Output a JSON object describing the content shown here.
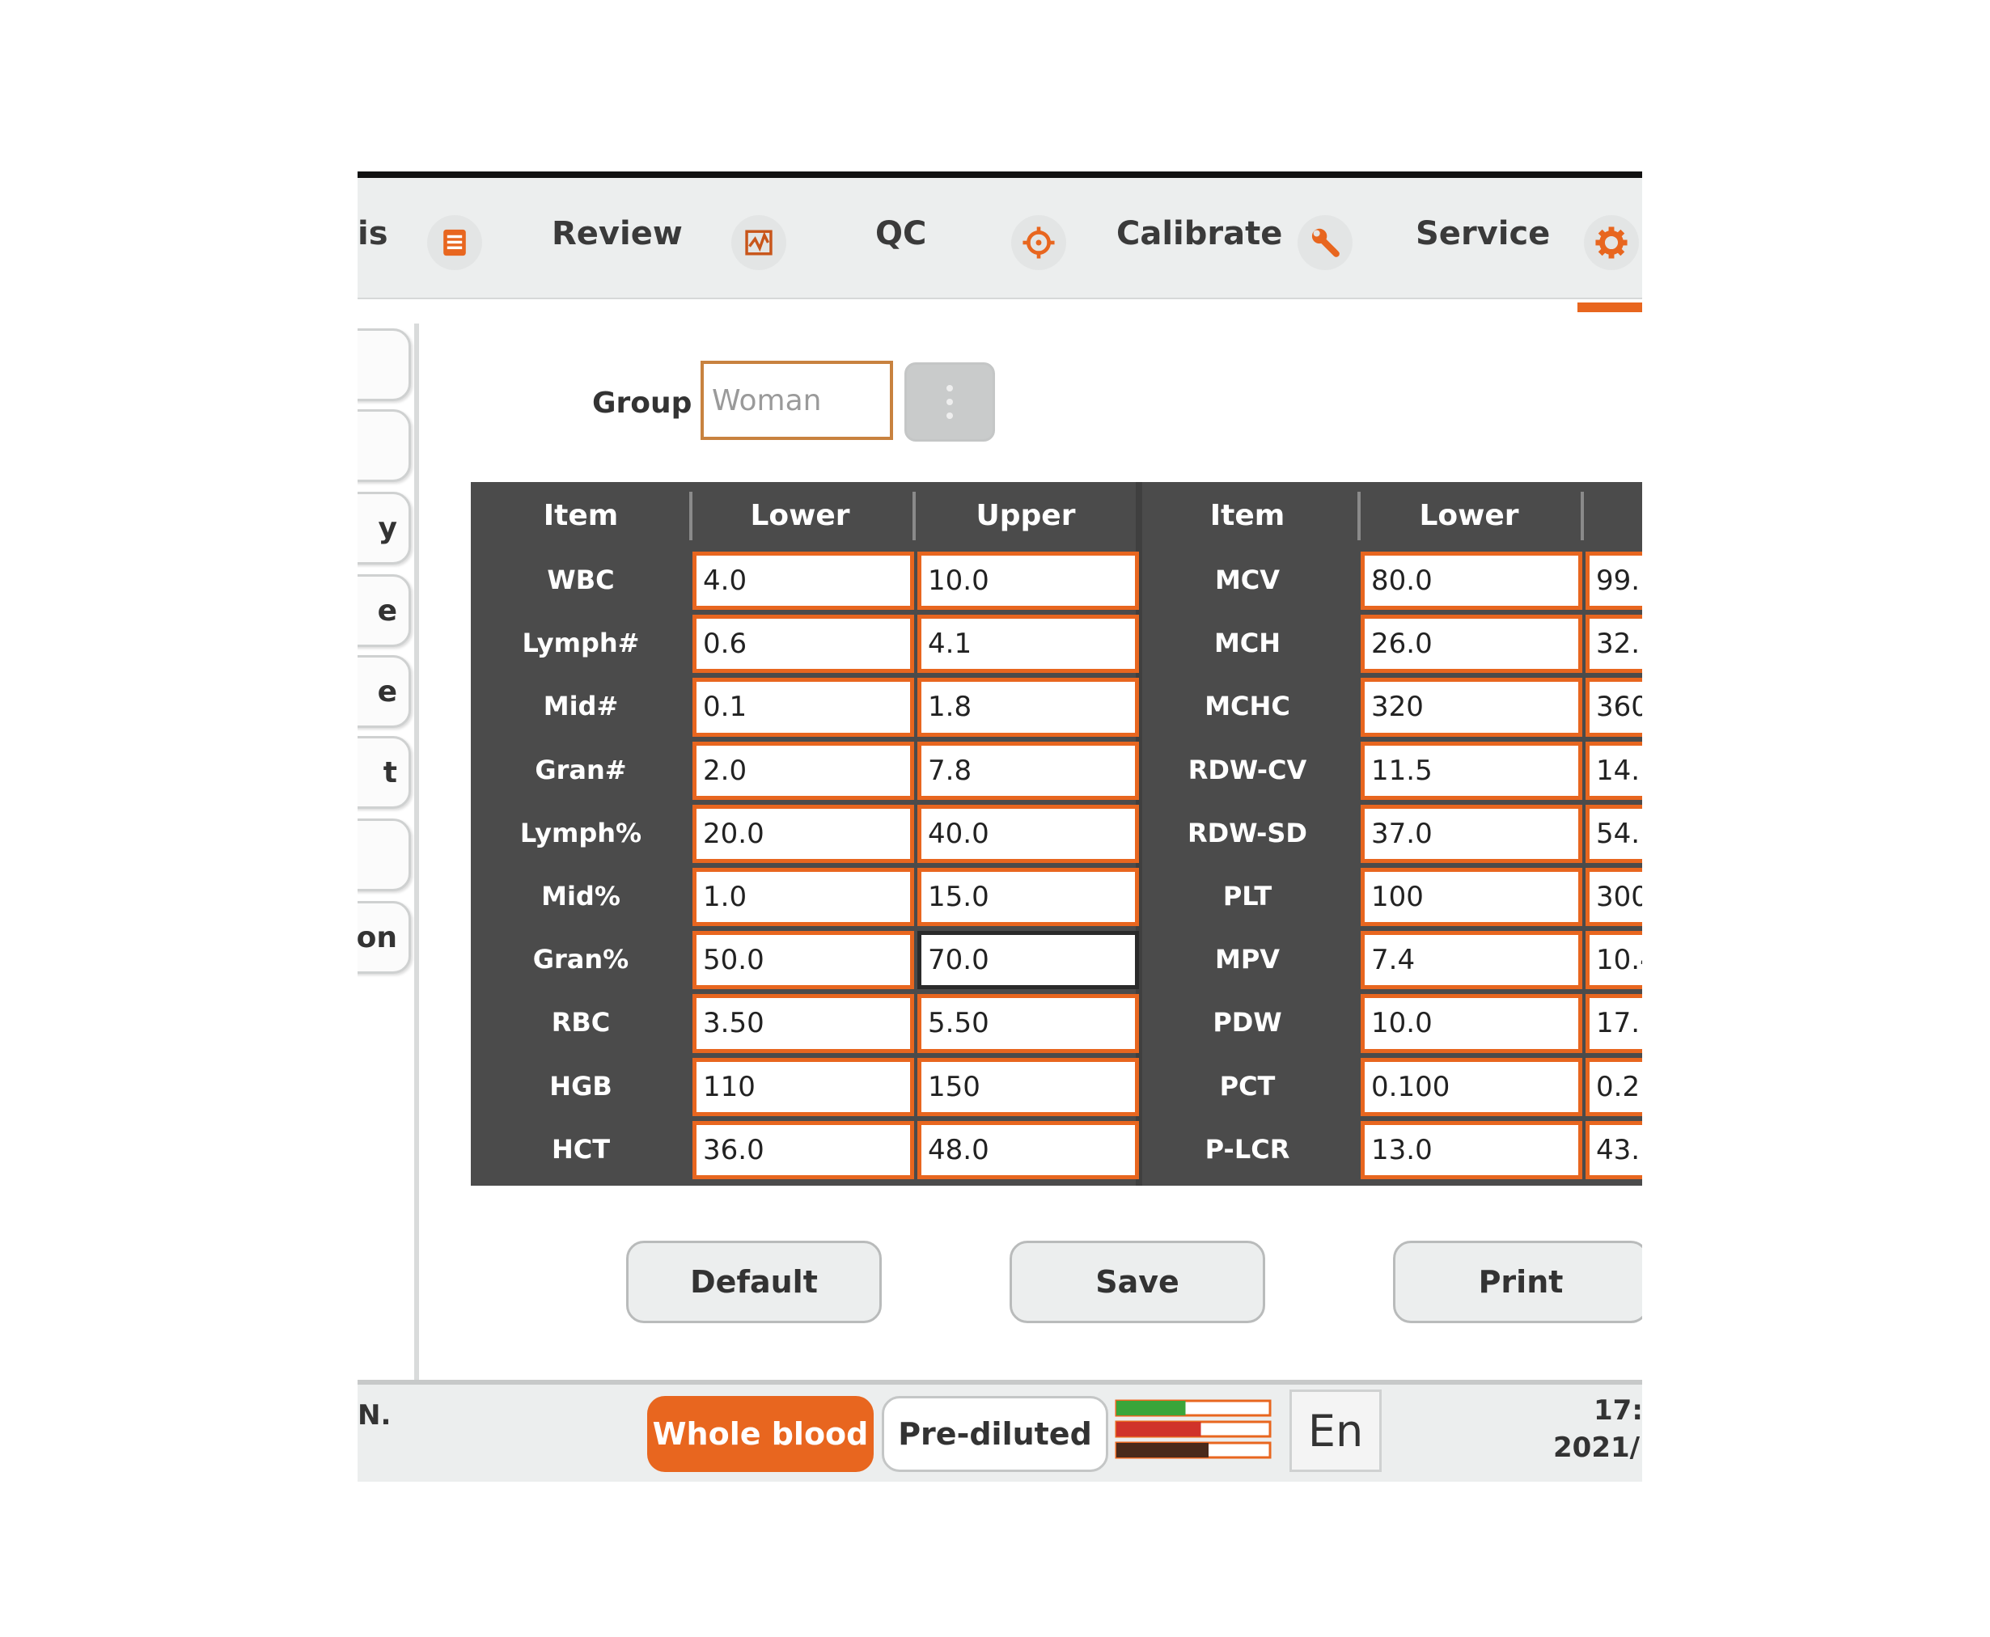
{
  "nav": {
    "partial_label": "is",
    "review": "Review",
    "qc": "QC",
    "calibrate": "Calibrate",
    "service": "Service",
    "icons": [
      "list-icon",
      "chart-icon",
      "crosshair-icon",
      "wrench-icon",
      "gear-icon"
    ],
    "accent": "#e8661f"
  },
  "side_tabs": [
    "",
    "",
    "y",
    "e",
    "e",
    "t",
    "",
    "on"
  ],
  "group": {
    "label": "Group",
    "value": "Woman"
  },
  "table": {
    "headers": [
      "Item",
      "Lower",
      "Upper",
      "Item",
      "Lower",
      ""
    ],
    "left_rows": [
      {
        "item": "WBC",
        "lower": "4.0",
        "upper": "10.0"
      },
      {
        "item": "Lymph#",
        "lower": "0.6",
        "upper": "4.1"
      },
      {
        "item": "Mid#",
        "lower": "0.1",
        "upper": "1.8"
      },
      {
        "item": "Gran#",
        "lower": "2.0",
        "upper": "7.8"
      },
      {
        "item": "Lymph%",
        "lower": "20.0",
        "upper": "40.0"
      },
      {
        "item": "Mid%",
        "lower": "1.0",
        "upper": "15.0"
      },
      {
        "item": "Gran%",
        "lower": "50.0",
        "upper": "70.0"
      },
      {
        "item": "RBC",
        "lower": "3.50",
        "upper": "5.50"
      },
      {
        "item": "HGB",
        "lower": "110",
        "upper": "150"
      },
      {
        "item": "HCT",
        "lower": "36.0",
        "upper": "48.0"
      }
    ],
    "right_rows": [
      {
        "item": "MCV",
        "lower": "80.0",
        "upper": "99.("
      },
      {
        "item": "MCH",
        "lower": "26.0",
        "upper": "32.("
      },
      {
        "item": "MCHC",
        "lower": "320",
        "upper": "360"
      },
      {
        "item": "RDW-CV",
        "lower": "11.5",
        "upper": "14.!"
      },
      {
        "item": "RDW-SD",
        "lower": "37.0",
        "upper": "54.("
      },
      {
        "item": "PLT",
        "lower": "100",
        "upper": "300"
      },
      {
        "item": "MPV",
        "lower": "7.4",
        "upper": "10.4"
      },
      {
        "item": "PDW",
        "lower": "10.0",
        "upper": "17.("
      },
      {
        "item": "PCT",
        "lower": "0.100",
        "upper": "0.2!"
      },
      {
        "item": "P-LCR",
        "lower": "13.0",
        "upper": "43.("
      }
    ],
    "selected_cell": "Gran%.upper"
  },
  "buttons": {
    "default": "Default",
    "save": "Save",
    "print": "Print"
  },
  "status": {
    "left_text": "N.",
    "mode_whole": "Whole blood",
    "mode_prediluted": "Pre-diluted",
    "language": "En",
    "time": "17:1",
    "date": "2021/1",
    "reagent_colors": [
      "#3aa53a",
      "#d0332a",
      "#4a2a1a"
    ]
  }
}
